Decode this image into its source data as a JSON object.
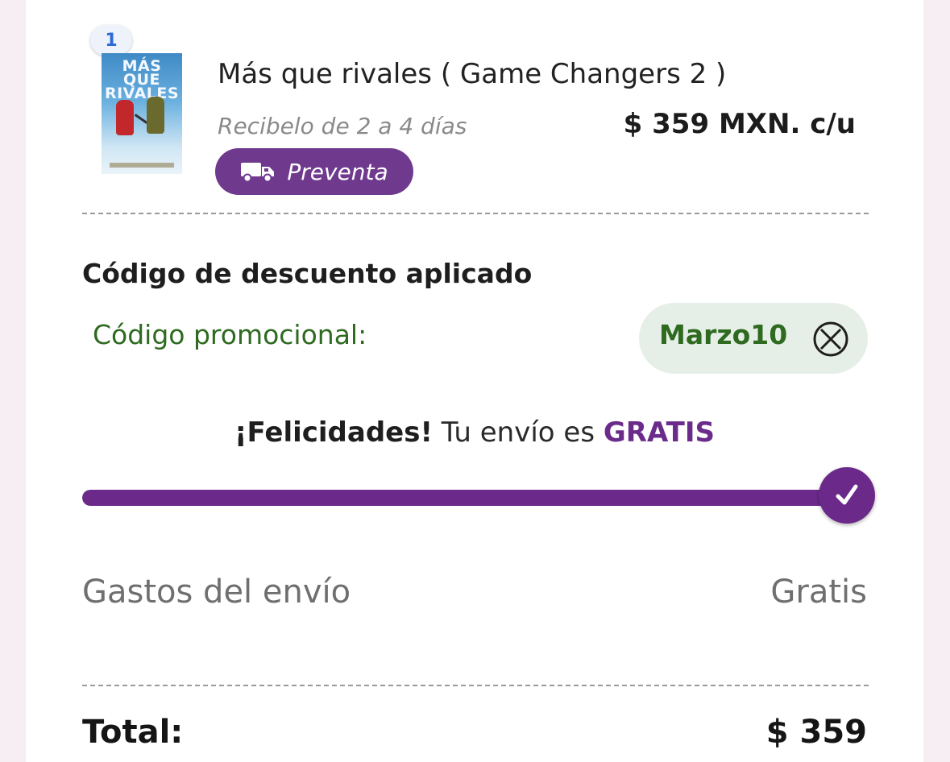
{
  "item": {
    "quantity": "1",
    "cover_title": "MÁS QUE RIVALES",
    "title": "Más que rivales ( Game Changers 2 )",
    "delivery": "Recibelo de 2 a 4 días",
    "price": "$ 359 MXN. c/u",
    "badge_label": "Preventa",
    "badge_icon": "truck-icon"
  },
  "discount": {
    "heading": "Código de descuento aplicado",
    "promo_label": "Código promocional:",
    "code": "Marzo10",
    "remove_icon": "close-circle-icon"
  },
  "shipping_progress": {
    "congrats_lead": "¡Felicidades!",
    "congrats_middle": "Tu envío es",
    "congrats_highlight": "GRATIS",
    "progress_fraction": 1.0,
    "complete_icon": "checkmark-icon"
  },
  "summary": {
    "shipping_label": "Gastos del envío",
    "shipping_value": "Gratis",
    "total_label": "Total:",
    "total_value": "$ 359"
  },
  "colors": {
    "brand_purple": "#6b2a8a",
    "promo_green": "#2e6a1f",
    "promo_chip_bg": "#e6efe7",
    "qty_blue": "#2d6ad9"
  }
}
